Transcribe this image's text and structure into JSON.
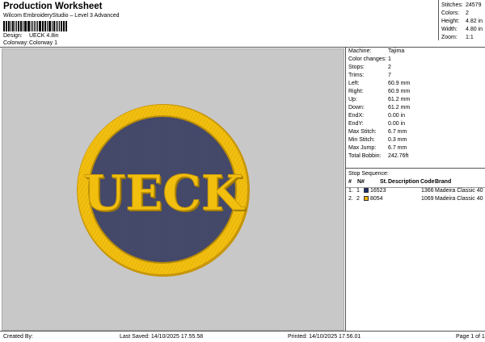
{
  "header": {
    "title": "Production Worksheet",
    "subtitle": "Wilcom EmbroideryStudio – Level 3 Advanced",
    "design_label": "Design:",
    "design_value": "UECK 4.8in",
    "colorway_label": "Colorway:",
    "colorway_value": "Colorway 1"
  },
  "info": {
    "stitches_label": "Stitches:",
    "stitches_value": "24579",
    "colors_label": "Colors:",
    "colors_value": "2",
    "height_label": "Height:",
    "height_value": "4.82 in",
    "width_label": "Width:",
    "width_value": "4.80 in",
    "zoom_label": "Zoom:",
    "zoom_value": "1:1"
  },
  "design": {
    "text": "UECK",
    "colors": {
      "fill": "#45496a",
      "gold": "#f2bf0f",
      "background": "#c8c8c8"
    }
  },
  "machine": {
    "items": [
      {
        "label": "Machine:",
        "value": "Tajima"
      },
      {
        "label": "Color changes:",
        "value": "1"
      },
      {
        "label": "Stops:",
        "value": "2"
      },
      {
        "label": "Trims:",
        "value": "7"
      },
      {
        "label": "Left:",
        "value": "60.9 mm"
      },
      {
        "label": "Right:",
        "value": "60.9 mm"
      },
      {
        "label": "Up:",
        "value": "61.2 mm"
      },
      {
        "label": "Down:",
        "value": "61.2 mm"
      },
      {
        "label": "EndX:",
        "value": "0.00 in"
      },
      {
        "label": "EndY:",
        "value": "0.00 in"
      },
      {
        "label": "Max Stitch:",
        "value": "6.7 mm"
      },
      {
        "label": "Min Stitch:",
        "value": "0.3 mm"
      },
      {
        "label": "Max Jump:",
        "value": "6.7 mm"
      },
      {
        "label": "Total Bobbin:",
        "value": "242.76ft"
      }
    ]
  },
  "stops": {
    "title": "Stop Sequence:",
    "headers": {
      "num": "#",
      "n": "N#",
      "st": "St.",
      "desc": "Description",
      "code": "Code",
      "brand": "Brand"
    },
    "rows": [
      {
        "num": "1.",
        "n": "1",
        "color": "#1c2f6e",
        "code_num": "16523",
        "st": "1366",
        "brand": "Madeira Classic 40"
      },
      {
        "num": "2.",
        "n": "2",
        "color": "#f2b20a",
        "code_num": "8054",
        "st": "1069",
        "brand": "Madeira Classic 40"
      }
    ]
  },
  "footer": {
    "created_by": "Created By:",
    "last_saved": "Last Saved: 14/10/2025 17.55.58",
    "printed": "Printed: 14/10/2025 17.56.01",
    "page": "Page 1 of 1"
  }
}
